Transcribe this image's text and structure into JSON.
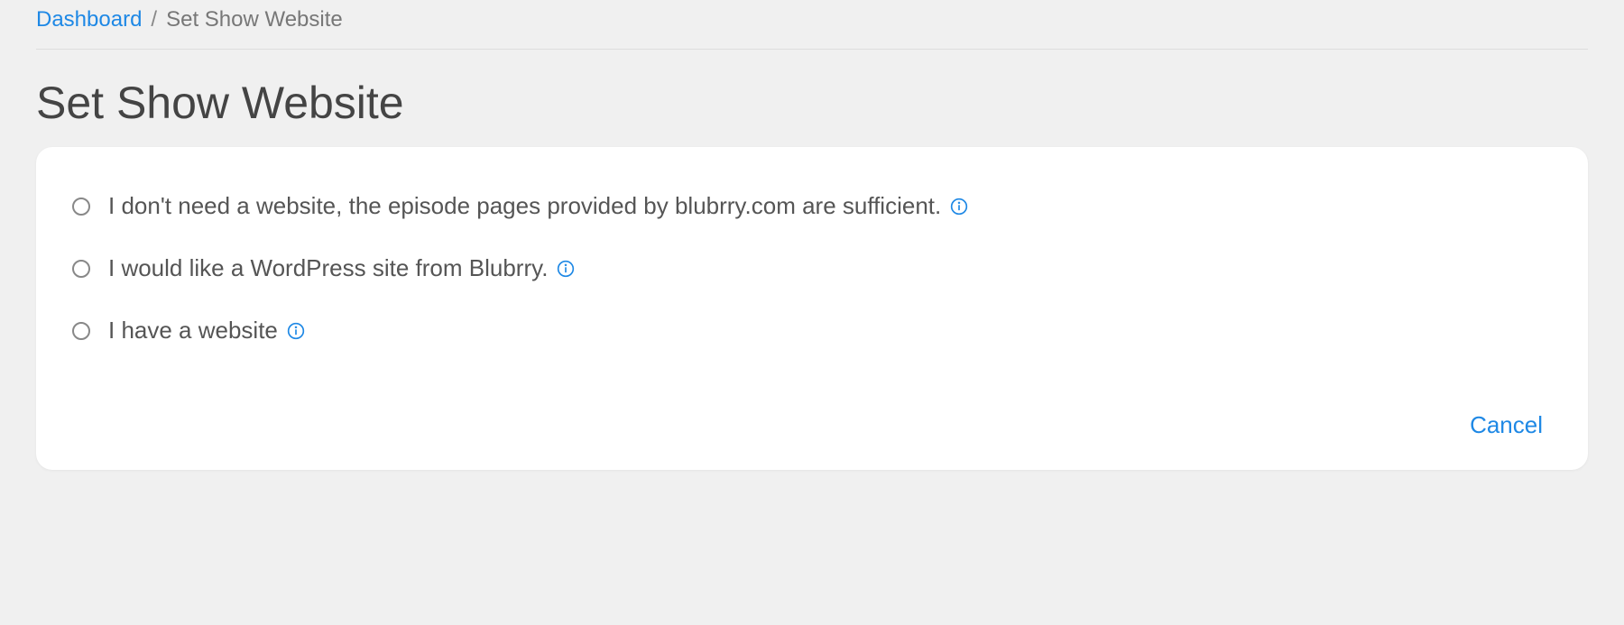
{
  "breadcrumb": {
    "home_label": "Dashboard",
    "separator": "/",
    "current_label": "Set Show Website"
  },
  "page": {
    "title": "Set Show Website"
  },
  "options": [
    {
      "label": "I don't need a website, the episode pages provided by blubrry.com are sufficient."
    },
    {
      "label": "I would like a WordPress site from Blubrry."
    },
    {
      "label": "I have a website"
    }
  ],
  "actions": {
    "cancel_label": "Cancel"
  }
}
